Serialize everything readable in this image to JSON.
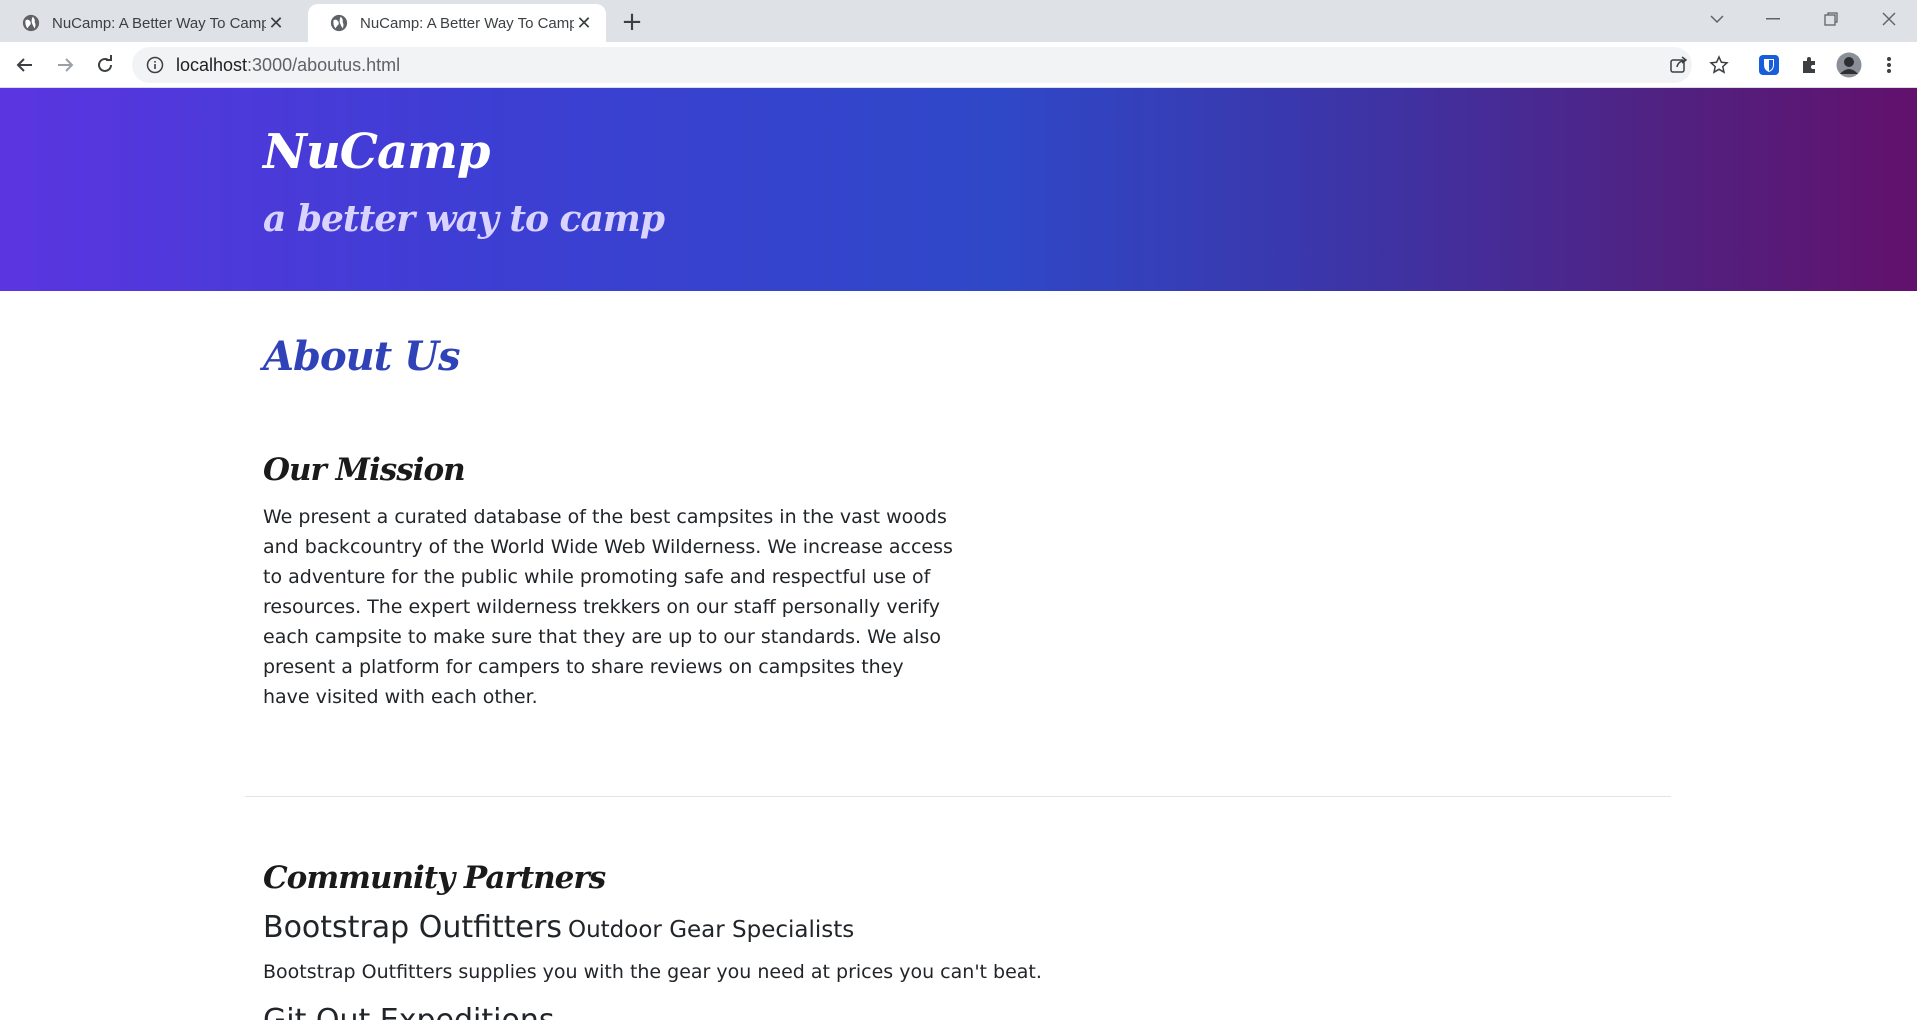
{
  "browser": {
    "tabs": [
      {
        "title": "NuCamp: A Better Way To Camp",
        "active": false
      },
      {
        "title": "NuCamp: A Better Way To Camp",
        "active": true
      }
    ],
    "address": {
      "host": "localhost",
      "path": ":3000/aboutus.html"
    }
  },
  "header": {
    "brand": "NuCamp",
    "tagline": "a better way to camp"
  },
  "about": {
    "title": "About Us",
    "mission_title": "Our Mission",
    "mission_text": "We present a curated database of the best campsites in the vast woods and backcountry of the World Wide Web Wilderness. We increase access to adventure for the public while promoting safe and respectful use of resources. The expert wilderness trekkers on our staff personally verify each campsite to make sure that they are up to our standards. We also present a platform for campers to share reviews on campsites they have visited with each other."
  },
  "partners": {
    "title": "Community Partners",
    "items": [
      {
        "name": "Bootstrap Outfitters",
        "tagline": "Outdoor Gear Specialists",
        "description": "Bootstrap Outfitters supplies you with the gear you need at prices you can't beat."
      },
      {
        "name": "Git Out Expeditions"
      }
    ]
  },
  "colors": {
    "heading_blue": "#3042b8",
    "gradient_start": "#5b35e0",
    "gradient_end": "#62116c"
  }
}
